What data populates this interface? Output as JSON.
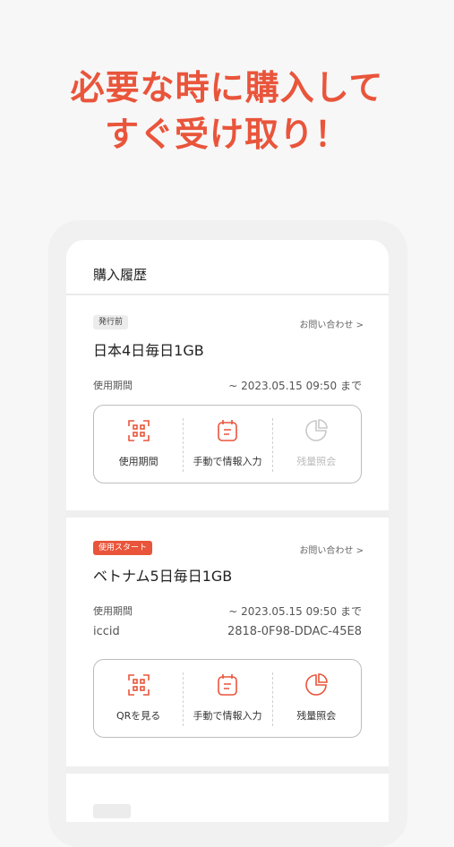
{
  "headline": {
    "line1": "必要な時に購入して",
    "line2": "すぐ受け取り！"
  },
  "header": {
    "title": "購入履歴"
  },
  "cards": [
    {
      "badge": "発行前",
      "contact": "お問い合わせ >",
      "plan": "日本4日毎日1GB",
      "period_label": "使用期間",
      "period_value": "~ 2023.05.15 09:50 まで",
      "actions": [
        {
          "label": "使用期間",
          "icon": "qr-code-icon",
          "enabled": true
        },
        {
          "label": "手動で情報入力",
          "icon": "calendar-icon",
          "enabled": true
        },
        {
          "label": "残量照会",
          "icon": "pie-chart-icon",
          "enabled": false
        }
      ]
    },
    {
      "badge": "使用スタート",
      "contact": "お問い合わせ >",
      "plan": "ベトナム5日毎日1GB",
      "period_label": "使用期間",
      "period_value": "~ 2023.05.15 09:50 まで",
      "iccid_label": "iccid",
      "iccid_value": "2818-0F98-DDAC-45E8",
      "actions": [
        {
          "label": "QRを見る",
          "icon": "qr-code-icon",
          "enabled": true
        },
        {
          "label": "手動で情報入力",
          "icon": "calendar-icon",
          "enabled": true
        },
        {
          "label": "残量照会",
          "icon": "pie-chart-icon",
          "enabled": true
        }
      ]
    }
  ],
  "colors": {
    "accent": "#e9553b",
    "disabled": "#c8c8c8"
  }
}
